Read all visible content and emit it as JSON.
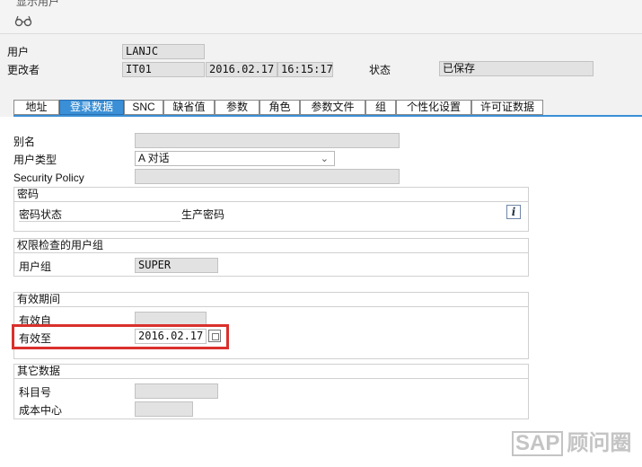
{
  "window": {
    "title": "显示用户"
  },
  "toolbar": {
    "display_icon": "glasses-icon"
  },
  "header": {
    "user_label": "用户",
    "user_value": "LANJC",
    "changed_by_label": "更改者",
    "changed_by_value": "IT01",
    "change_date": "2016.02.17",
    "change_time": "16:15:17",
    "status_label": "状态",
    "status_value": "已保存"
  },
  "tabs": [
    {
      "label": "地址",
      "active": false
    },
    {
      "label": "登录数据",
      "active": true
    },
    {
      "label": "SNC",
      "active": false
    },
    {
      "label": "缺省值",
      "active": false
    },
    {
      "label": "参数",
      "active": false
    },
    {
      "label": "角色",
      "active": false
    },
    {
      "label": "参数文件",
      "active": false
    },
    {
      "label": "组",
      "active": false
    },
    {
      "label": "个性化设置",
      "active": false
    },
    {
      "label": "许可证数据",
      "active": false
    }
  ],
  "logon": {
    "alias_label": "别名",
    "alias_value": "",
    "user_type_label": "用户类型",
    "user_type_value": "A 对话",
    "security_policy_label": "Security Policy",
    "security_policy_value": ""
  },
  "password": {
    "group_title": "密码",
    "status_label": "密码状态",
    "status_value": "生产密码",
    "info_icon": "info-icon"
  },
  "auth_group": {
    "group_title": "权限检查的用户组",
    "user_group_label": "用户组",
    "user_group_value": "SUPER"
  },
  "validity": {
    "group_title": "有效期间",
    "valid_from_label": "有效自",
    "valid_from_value": "",
    "valid_to_label": "有效至",
    "valid_to_value": "2016.02.17",
    "highlight_color": "#d9302c"
  },
  "other": {
    "group_title": "其它数据",
    "account_label": "科目号",
    "account_value": "",
    "cost_center_label": "成本中心",
    "cost_center_value": ""
  },
  "watermark": {
    "sap": "SAP",
    "text": "顾问圈"
  },
  "colors": {
    "accent": "#3a8fd6",
    "field_bg": "#e2e2e2"
  }
}
